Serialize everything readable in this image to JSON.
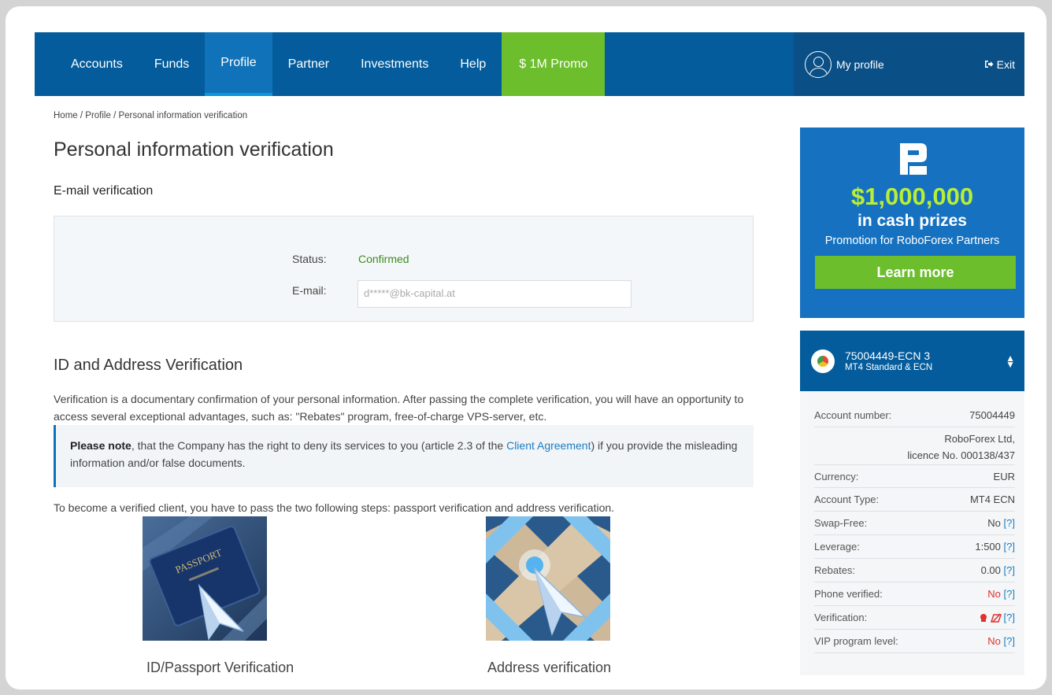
{
  "nav": {
    "items": [
      {
        "label": "Accounts",
        "active": false
      },
      {
        "label": "Funds",
        "active": false
      },
      {
        "label": "Profile",
        "active": true
      },
      {
        "label": "Partner",
        "active": false
      },
      {
        "label": "Investments",
        "active": false
      },
      {
        "label": "Help",
        "active": false
      }
    ],
    "promo_label": "$ 1M Promo",
    "my_profile": "My profile",
    "exit": "Exit"
  },
  "breadcrumb": {
    "home": "Home",
    "profile": "Profile",
    "current": "Personal information verification",
    "sep": " / "
  },
  "page": {
    "title": "Personal information verification",
    "email_section_title": "E-mail verification",
    "status_label": "Status:",
    "status_value": "Confirmed",
    "email_label": "E-mail:",
    "email_value": "d*****@bk-capital.at",
    "id_section_title": "ID and Address Verification",
    "intro": "Verification is a documentary confirmation of your personal information. After passing the complete verification, you will have an opportunity to access several exceptional advantages, such as: \"Rebates\" program, free-of-charge VPS-server, etc.",
    "note_bold": "Please note",
    "note_text_1": ", that the Company has the right to deny its services to you (article 2.3 of the ",
    "note_link": "Client Agreement",
    "note_text_2": ") if you provide the misleading information and/or false documents.",
    "steps_text": "To become a verified client, you have to pass the two following steps: passport verification and address verification.",
    "passport_img_text": "PASSPORT",
    "step1_label": "ID/Passport Verification",
    "step2_label": "Address verification"
  },
  "promo_banner": {
    "amount": "$1,000,000",
    "cash": "in cash prizes",
    "subtitle": "Promotion for RoboForex Partners",
    "button": "Learn more"
  },
  "account": {
    "name": "75004449-ECN 3",
    "type": "MT4 Standard & ECN",
    "rows": {
      "number_label": "Account number:",
      "number_value": "75004449",
      "company_line1": "RoboForex Ltd,",
      "company_line2": "licence No. 000138/437",
      "currency_label": "Currency:",
      "currency_value": "EUR",
      "type_label": "Account Type:",
      "type_value": "MT4 ECN",
      "swap_label": "Swap-Free:",
      "swap_value": "No",
      "leverage_label": "Leverage:",
      "leverage_value": "1:500",
      "rebates_label": "Rebates:",
      "rebates_value": "0.00",
      "phone_label": "Phone verified:",
      "phone_value": "No",
      "verification_label": "Verification:",
      "vip_label": "VIP program level:",
      "vip_value": "No",
      "help": "[?]"
    }
  },
  "colors": {
    "nav_bg": "#045c9c",
    "nav_active": "#1072b8",
    "promo_green": "#6cbe2d",
    "status_green": "#3c8c1c",
    "link_blue": "#1a7dc2",
    "no_red": "#e03030",
    "banner_bg": "#1672c0",
    "amount_green": "#b9ee36"
  }
}
